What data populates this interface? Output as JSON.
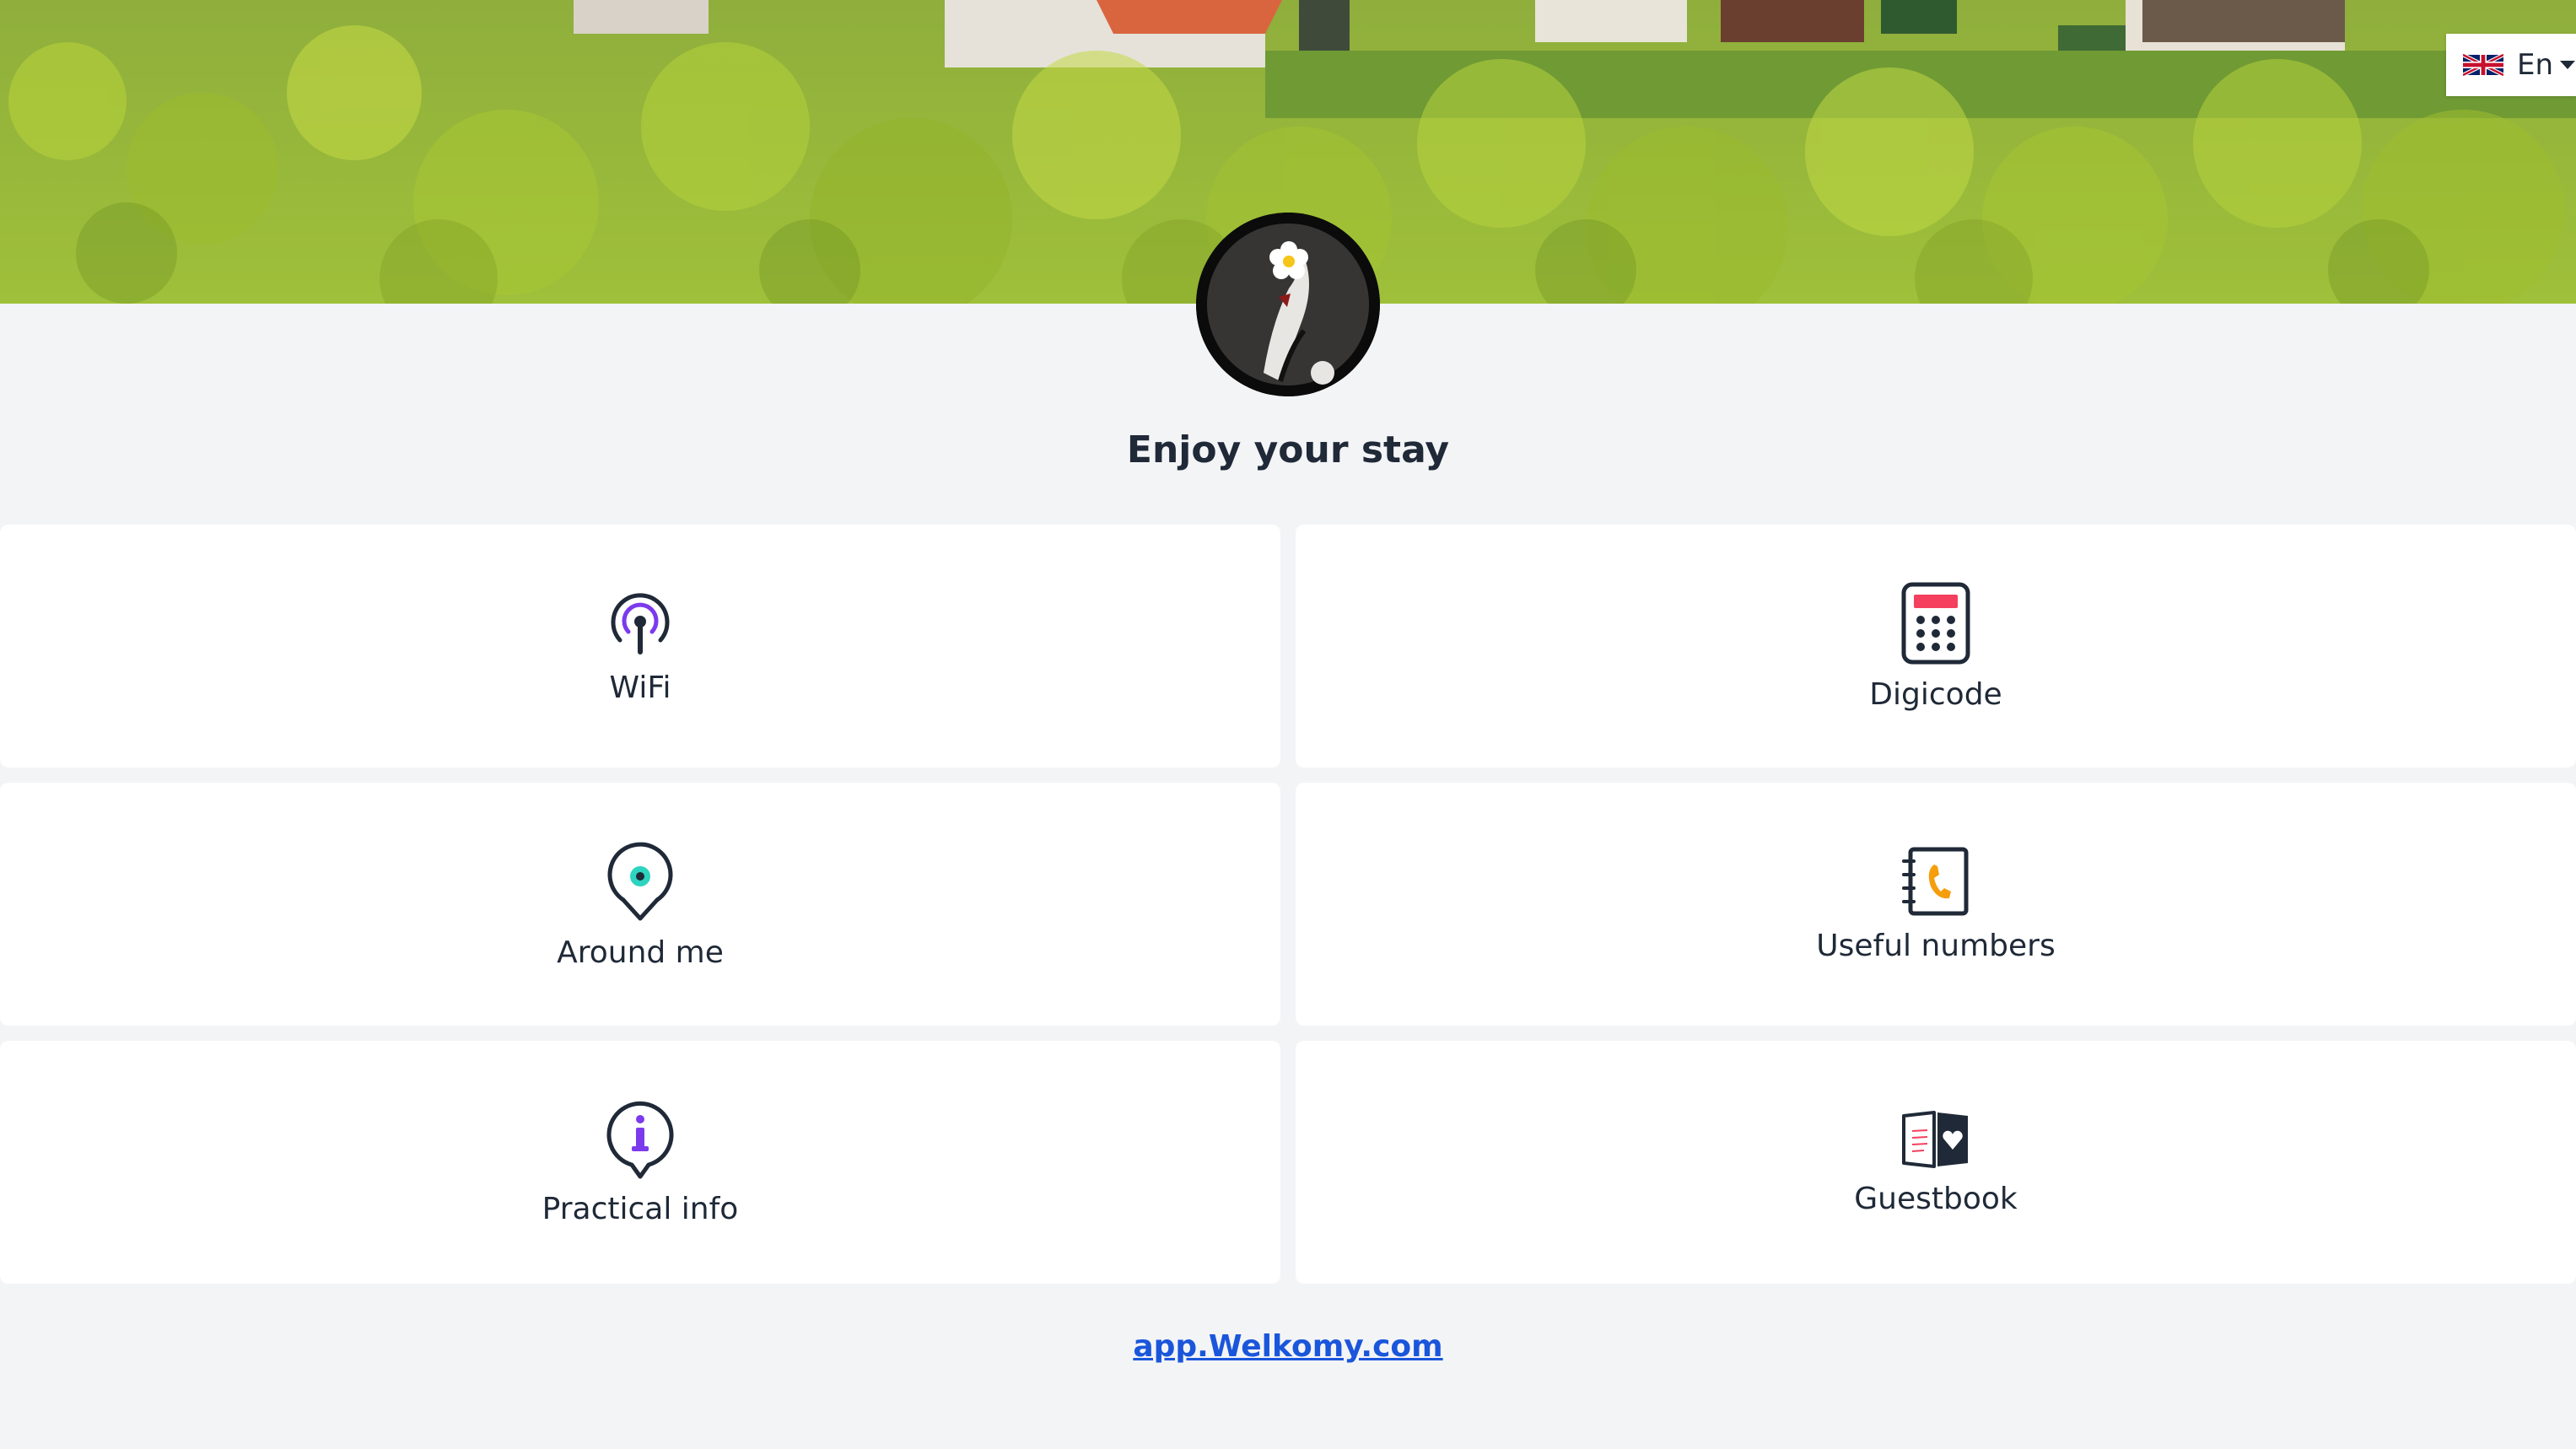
{
  "header": {
    "language": {
      "code": "En",
      "flag_icon": "uk-flag-icon"
    }
  },
  "profile": {
    "avatar_icon": "host-avatar-flower-photo"
  },
  "page": {
    "title": "Enjoy your stay"
  },
  "cards": [
    {
      "label": "WiFi",
      "icon": "wifi-icon"
    },
    {
      "label": "Digicode",
      "icon": "digicode-keypad-icon"
    },
    {
      "label": "Around me",
      "icon": "location-pin-icon"
    },
    {
      "label": "Useful numbers",
      "icon": "phonebook-icon"
    },
    {
      "label": "Practical info",
      "icon": "info-icon"
    },
    {
      "label": "Guestbook",
      "icon": "guestbook-icon"
    }
  ],
  "footer": {
    "link_text": "app.Welkomy.com"
  },
  "colors": {
    "background": "#f3f4f6",
    "card": "#ffffff",
    "text": "#1f2937",
    "link": "#1a56db",
    "accent_purple": "#7c3aed",
    "accent_teal": "#2dd4bf",
    "accent_red": "#f43f5e",
    "accent_orange": "#f59e0b"
  }
}
